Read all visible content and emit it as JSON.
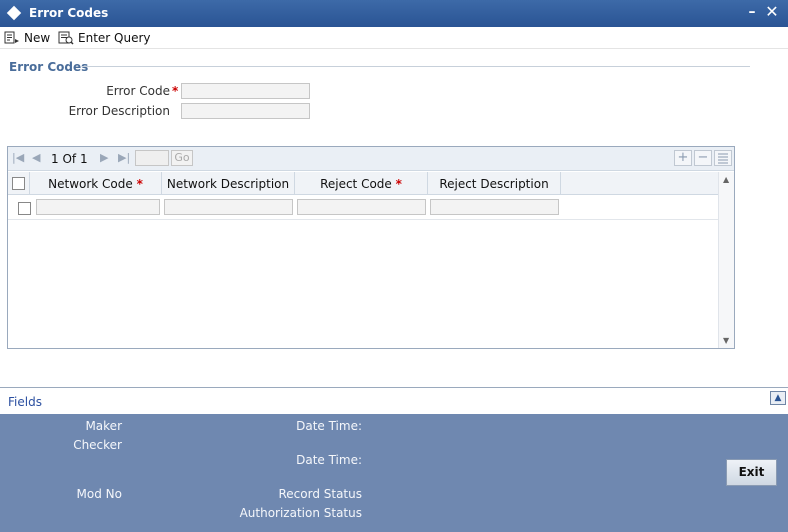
{
  "window": {
    "title": "Error Codes"
  },
  "toolbar": {
    "new_label": "New",
    "enter_query_label": "Enter Query"
  },
  "section": {
    "legend": "Error Codes"
  },
  "form": {
    "error_code_label": "Error Code",
    "error_code_value": "",
    "error_description_label": "Error Description",
    "error_description_value": "",
    "required_mark": "*"
  },
  "grid": {
    "page_current": "1",
    "page_of": "Of",
    "page_total": "1",
    "goto_value": "",
    "go_label": "Go",
    "columns": [
      {
        "label": "Network Code",
        "required": true
      },
      {
        "label": "Network Description",
        "required": false
      },
      {
        "label": "Reject Code",
        "required": true
      },
      {
        "label": "Reject Description",
        "required": false
      }
    ],
    "rows": [
      {
        "network_code": "",
        "network_description": "",
        "reject_code": "",
        "reject_description": ""
      }
    ]
  },
  "fields": {
    "label": "Fields"
  },
  "audit": {
    "maker_label": "Maker",
    "checker_label": "Checker",
    "date_time_label": "Date Time:",
    "mod_no_label": "Mod No",
    "record_status_label": "Record Status",
    "authorization_status_label": "Authorization Status",
    "exit_label": "Exit"
  },
  "colors": {
    "titlebar": "#2a5494",
    "audit_bg": "#6f88b0",
    "required": "#cc0000",
    "legend": "#4a6d9a"
  },
  "icons": {
    "app": "diamond-icon",
    "minimize": "minimize-icon",
    "close": "close-icon",
    "new": "new-document-icon",
    "enter_query": "query-icon",
    "first": "first-page-icon",
    "prev": "previous-page-icon",
    "next": "next-page-icon",
    "last": "last-page-icon",
    "add_row": "plus-icon",
    "delete_row": "minus-icon",
    "single_view": "list-icon",
    "fields_toggle": "chevron-up-icon"
  }
}
